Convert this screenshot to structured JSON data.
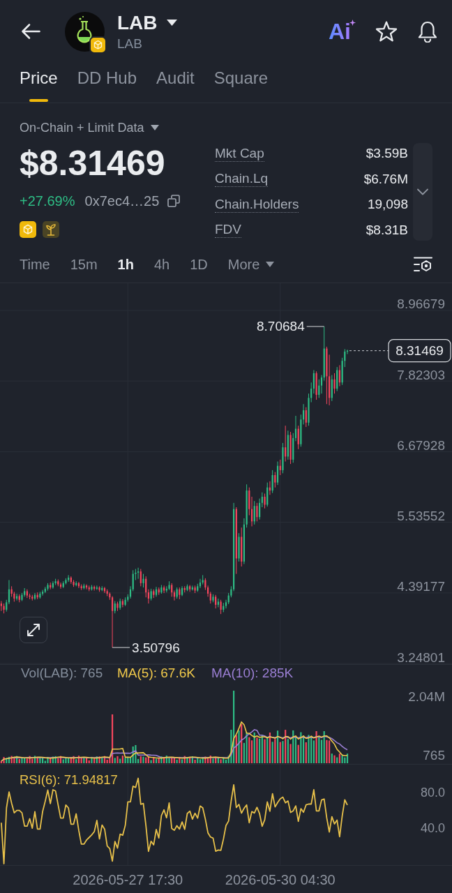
{
  "header": {
    "title": "LAB",
    "subtitle": "LAB",
    "ai_label": "Ai",
    "favorite": false
  },
  "tabs": [
    {
      "label": "Price",
      "selected": true
    },
    {
      "label": "DD Hub",
      "selected": false
    },
    {
      "label": "Audit",
      "selected": false
    },
    {
      "label": "Square",
      "selected": false
    }
  ],
  "data_source": "On-Chain + Limit Data",
  "price": {
    "value": "$8.31469",
    "change": "+27.69%",
    "address": "0x7ec4…25"
  },
  "stats": [
    {
      "label": "Mkt Cap",
      "value": "$3.59B"
    },
    {
      "label": "Chain.Lq",
      "value": "$6.76M"
    },
    {
      "label": "Chain.Holders",
      "value": "19,098"
    },
    {
      "label": "FDV",
      "value": "$8.31B"
    }
  ],
  "stats_panel": {
    "expanded": false
  },
  "intervals": [
    {
      "label": "Time",
      "kind": "option",
      "selected": false
    },
    {
      "label": "15m",
      "kind": "option",
      "selected": false
    },
    {
      "label": "1h",
      "kind": "option",
      "selected": true
    },
    {
      "label": "4h",
      "kind": "option",
      "selected": false
    },
    {
      "label": "1D",
      "kind": "option",
      "selected": false
    },
    {
      "label": "More",
      "kind": "menu",
      "selected": false
    }
  ],
  "price_chart": {
    "last_price_tag": "8.31469",
    "chart_data": {
      "type": "candlestick",
      "categories": [
        null,
        null,
        null,
        null,
        null,
        null,
        null,
        null,
        null,
        null,
        null,
        null,
        null,
        null,
        null,
        null,
        null,
        null,
        null,
        null,
        null,
        null,
        null,
        null,
        null,
        null,
        null,
        null,
        null,
        null,
        null,
        null,
        null,
        null,
        null,
        null,
        null,
        null,
        null,
        null,
        null,
        null,
        null,
        null,
        null,
        null,
        null,
        null,
        null,
        null,
        null,
        null,
        null,
        null,
        null,
        null,
        null,
        null,
        null,
        null,
        null,
        null,
        null,
        null,
        null,
        null,
        null,
        null,
        null,
        null,
        null,
        null,
        null,
        null,
        null,
        null,
        null,
        null,
        null,
        null,
        null,
        null,
        null,
        null,
        null,
        null,
        null,
        null,
        null,
        null,
        null,
        null,
        null,
        null,
        null,
        null,
        null,
        null,
        null,
        null,
        null,
        null,
        null,
        null,
        null,
        null,
        null,
        null,
        null,
        null,
        null,
        null,
        null,
        null,
        null,
        null,
        null,
        null,
        null,
        null,
        null,
        null,
        null,
        null,
        null,
        null,
        null,
        null,
        null,
        null,
        null,
        null,
        null,
        null,
        null,
        null,
        null,
        null,
        null,
        null,
        null,
        null,
        null,
        null,
        null,
        null,
        null,
        null,
        null,
        null,
        null,
        null,
        null,
        null,
        null,
        null,
        null,
        null,
        null,
        null,
        null,
        null,
        null,
        null,
        null,
        null,
        null,
        null,
        null,
        null,
        null,
        null,
        null,
        null,
        null
      ],
      "ohlc": [
        [
          4.22,
          4.26,
          4.1,
          4.18
        ],
        [
          4.18,
          4.22,
          4.06,
          4.12
        ],
        [
          4.12,
          4.28,
          4.09,
          4.24
        ],
        [
          4.24,
          4.6,
          4.21,
          4.45
        ],
        [
          4.45,
          4.5,
          4.33,
          4.38
        ],
        [
          4.38,
          4.41,
          4.25,
          4.3
        ],
        [
          4.3,
          4.38,
          4.27,
          4.34
        ],
        [
          4.34,
          4.37,
          4.24,
          4.28
        ],
        [
          4.28,
          4.39,
          4.26,
          4.36
        ],
        [
          4.36,
          4.47,
          4.33,
          4.42
        ],
        [
          4.42,
          4.45,
          4.31,
          4.35
        ],
        [
          4.35,
          4.38,
          4.29,
          4.33
        ],
        [
          4.33,
          4.36,
          4.27,
          4.3
        ],
        [
          4.3,
          4.39,
          4.28,
          4.36
        ],
        [
          4.36,
          4.4,
          4.29,
          4.32
        ],
        [
          4.32,
          4.41,
          4.3,
          4.38
        ],
        [
          4.38,
          4.44,
          4.35,
          4.41
        ],
        [
          4.41,
          4.49,
          4.39,
          4.46
        ],
        [
          4.46,
          4.55,
          4.43,
          4.52
        ],
        [
          4.52,
          4.56,
          4.45,
          4.48
        ],
        [
          4.48,
          4.58,
          4.46,
          4.55
        ],
        [
          4.55,
          4.62,
          4.52,
          4.58
        ],
        [
          4.58,
          4.61,
          4.5,
          4.53
        ],
        [
          4.53,
          4.56,
          4.46,
          4.49
        ],
        [
          4.49,
          4.58,
          4.47,
          4.55
        ],
        [
          4.55,
          4.63,
          4.53,
          4.6
        ],
        [
          4.6,
          4.68,
          4.57,
          4.64
        ],
        [
          4.64,
          4.66,
          4.54,
          4.57
        ],
        [
          4.57,
          4.6,
          4.49,
          4.52
        ],
        [
          4.52,
          4.58,
          4.5,
          4.55
        ],
        [
          4.55,
          4.57,
          4.47,
          4.5
        ],
        [
          4.5,
          4.53,
          4.44,
          4.47
        ],
        [
          4.47,
          4.54,
          4.45,
          4.51
        ],
        [
          4.51,
          4.53,
          4.45,
          4.48
        ],
        [
          4.48,
          4.51,
          4.42,
          4.45
        ],
        [
          4.45,
          4.52,
          4.43,
          4.49
        ],
        [
          4.49,
          4.51,
          4.43,
          4.46
        ],
        [
          4.46,
          4.51,
          4.44,
          4.48
        ],
        [
          4.48,
          4.5,
          4.41,
          4.44
        ],
        [
          4.44,
          4.5,
          4.42,
          4.47
        ],
        [
          4.47,
          4.49,
          4.39,
          4.42
        ],
        [
          4.42,
          4.45,
          4.34,
          4.38
        ],
        [
          4.38,
          4.4,
          4.28,
          4.32
        ],
        [
          4.32,
          4.34,
          3.50796,
          4.1
        ],
        [
          4.1,
          4.26,
          4.06,
          4.22
        ],
        [
          4.22,
          4.25,
          4.1,
          4.15
        ],
        [
          4.15,
          4.3,
          4.12,
          4.26
        ],
        [
          4.26,
          4.29,
          4.16,
          4.2
        ],
        [
          4.2,
          4.32,
          4.18,
          4.28
        ],
        [
          4.28,
          4.37,
          4.25,
          4.33
        ],
        [
          4.33,
          4.5,
          4.3,
          4.45
        ],
        [
          4.45,
          4.76,
          4.42,
          4.7
        ],
        [
          4.7,
          4.78,
          4.6,
          4.72
        ],
        [
          4.72,
          4.8,
          4.62,
          4.74
        ],
        [
          4.74,
          4.78,
          4.5,
          4.55
        ],
        [
          4.55,
          4.7,
          4.48,
          4.62
        ],
        [
          4.62,
          4.66,
          4.32,
          4.4
        ],
        [
          4.4,
          4.45,
          4.22,
          4.3
        ],
        [
          4.3,
          4.46,
          4.27,
          4.42
        ],
        [
          4.42,
          4.45,
          4.31,
          4.36
        ],
        [
          4.36,
          4.49,
          4.33,
          4.45
        ],
        [
          4.45,
          4.48,
          4.36,
          4.4
        ],
        [
          4.4,
          4.52,
          4.38,
          4.48
        ],
        [
          4.48,
          4.51,
          4.39,
          4.43
        ],
        [
          4.43,
          4.5,
          4.4,
          4.46
        ],
        [
          4.46,
          4.58,
          4.44,
          4.52
        ],
        [
          4.52,
          4.55,
          4.33,
          4.4
        ],
        [
          4.4,
          4.43,
          4.27,
          4.33
        ],
        [
          4.33,
          4.48,
          4.3,
          4.45
        ],
        [
          4.45,
          4.48,
          4.29,
          4.36
        ],
        [
          4.36,
          4.5,
          4.34,
          4.47
        ],
        [
          4.47,
          4.5,
          4.4,
          4.44
        ],
        [
          4.44,
          4.53,
          4.42,
          4.5
        ],
        [
          4.5,
          4.52,
          4.41,
          4.45
        ],
        [
          4.45,
          4.51,
          4.43,
          4.48
        ],
        [
          4.48,
          4.51,
          4.39,
          4.43
        ],
        [
          4.43,
          4.54,
          4.41,
          4.5
        ],
        [
          4.5,
          4.62,
          4.47,
          4.56
        ],
        [
          4.56,
          4.68,
          4.53,
          4.6
        ],
        [
          4.6,
          4.63,
          4.44,
          4.48
        ],
        [
          4.48,
          4.51,
          4.33,
          4.38
        ],
        [
          4.38,
          4.41,
          4.22,
          4.27
        ],
        [
          4.27,
          4.37,
          4.24,
          4.33
        ],
        [
          4.33,
          4.36,
          4.14,
          4.2
        ],
        [
          4.2,
          4.3,
          4.16,
          4.25
        ],
        [
          4.25,
          4.28,
          4.05,
          4.12
        ],
        [
          4.12,
          4.23,
          4.08,
          4.18
        ],
        [
          4.18,
          4.28,
          4.14,
          4.24
        ],
        [
          4.24,
          4.39,
          4.21,
          4.35
        ],
        [
          4.35,
          4.5,
          4.32,
          4.45
        ],
        [
          4.45,
          5.85,
          4.42,
          5.75
        ],
        [
          5.75,
          5.78,
          4.7,
          4.95
        ],
        [
          4.95,
          5.36,
          4.9,
          5.3
        ],
        [
          5.3,
          5.45,
          4.82,
          4.9
        ],
        [
          4.9,
          5.6,
          4.86,
          5.5
        ],
        [
          5.5,
          6.15,
          5.45,
          6.05
        ],
        [
          6.05,
          6.1,
          5.65,
          5.75
        ],
        [
          5.75,
          5.95,
          5.47,
          5.55
        ],
        [
          5.55,
          5.88,
          5.5,
          5.8
        ],
        [
          5.8,
          5.85,
          5.55,
          5.62
        ],
        [
          5.62,
          5.92,
          5.58,
          5.85
        ],
        [
          5.85,
          6.02,
          5.78,
          5.95
        ],
        [
          5.95,
          6.0,
          5.76,
          5.82
        ],
        [
          5.82,
          6.18,
          5.79,
          6.1
        ],
        [
          6.1,
          6.2,
          5.98,
          6.05
        ],
        [
          6.05,
          6.38,
          6.01,
          6.3
        ],
        [
          6.3,
          6.35,
          6.1,
          6.18
        ],
        [
          6.18,
          6.52,
          6.14,
          6.45
        ],
        [
          6.45,
          6.55,
          6.3,
          6.38
        ],
        [
          6.38,
          6.82,
          6.33,
          6.75
        ],
        [
          6.75,
          7.1,
          6.52,
          6.6
        ],
        [
          6.6,
          7.02,
          6.55,
          6.95
        ],
        [
          6.95,
          7.0,
          6.48,
          6.55
        ],
        [
          6.55,
          6.98,
          6.5,
          6.9
        ],
        [
          6.9,
          7.26,
          6.85,
          7.05
        ],
        [
          7.05,
          7.1,
          6.72,
          6.8
        ],
        [
          6.8,
          7.28,
          6.76,
          7.2
        ],
        [
          7.2,
          7.45,
          7.12,
          7.35
        ],
        [
          7.35,
          7.4,
          7.08,
          7.15
        ],
        [
          7.15,
          7.62,
          7.1,
          7.55
        ],
        [
          7.55,
          7.8,
          7.48,
          7.7
        ],
        [
          7.7,
          8.0,
          7.62,
          7.95
        ],
        [
          7.95,
          7.98,
          7.52,
          7.6
        ],
        [
          7.6,
          7.85,
          7.55,
          7.75
        ],
        [
          7.75,
          7.92,
          7.62,
          7.88
        ],
        [
          7.88,
          8.70684,
          7.83,
          8.35
        ],
        [
          8.35,
          8.38,
          7.45,
          7.9
        ],
        [
          7.9,
          8.25,
          7.43,
          7.55
        ],
        [
          7.55,
          7.92,
          7.5,
          7.85
        ],
        [
          7.85,
          7.95,
          7.62,
          7.7
        ],
        [
          7.7,
          8.05,
          7.66,
          8.0
        ],
        [
          8.0,
          8.08,
          7.74,
          7.8
        ],
        [
          7.8,
          8.2,
          7.76,
          8.15
        ],
        [
          8.15,
          8.34,
          8.05,
          8.3
        ],
        [
          8.3,
          8.33,
          8.26,
          8.31469
        ],
        null,
        null,
        null,
        null,
        null,
        null,
        null,
        null,
        null,
        null,
        null,
        null,
        null,
        null,
        null,
        null,
        null,
        null,
        null,
        null,
        null,
        null,
        null,
        null,
        null,
        null,
        null,
        null,
        null,
        null,
        null,
        null,
        null,
        null,
        null,
        null,
        null,
        null,
        null,
        null
      ],
      "ylim": [
        3.238,
        9.407
      ],
      "yticks": [
        {
          "value": 8.96679,
          "label": "8.96679"
        },
        {
          "value": 7.82303,
          "label": "7.82303"
        },
        {
          "value": 6.67928,
          "label": "6.67928"
        },
        {
          "value": 5.53552,
          "label": "5.53552"
        },
        {
          "value": 4.39177,
          "label": "4.39177"
        },
        {
          "value": 3.24801,
          "label": "3.24801"
        }
      ],
      "grid": true,
      "annotations": [
        "8.70684",
        "3.50796"
      ]
    }
  },
  "volume_chart": {
    "legend": [
      {
        "label": "Vol(LAB): 765",
        "color": "#848e9c"
      },
      {
        "label": "MA(5): 67.6K",
        "color": "#f0c94b"
      },
      {
        "label": "MA(10): 285K",
        "color": "#9b7fd4"
      }
    ],
    "axis_labels": [
      "2.04M",
      "765"
    ]
  },
  "rsi_chart": {
    "legend": "RSI(6): 71.94817",
    "axis_labels": [
      "80.0",
      "40.0"
    ]
  },
  "time_axis": {
    "labels": [
      "2026-05-27 17:30",
      "2026-05-30 04:30"
    ]
  }
}
